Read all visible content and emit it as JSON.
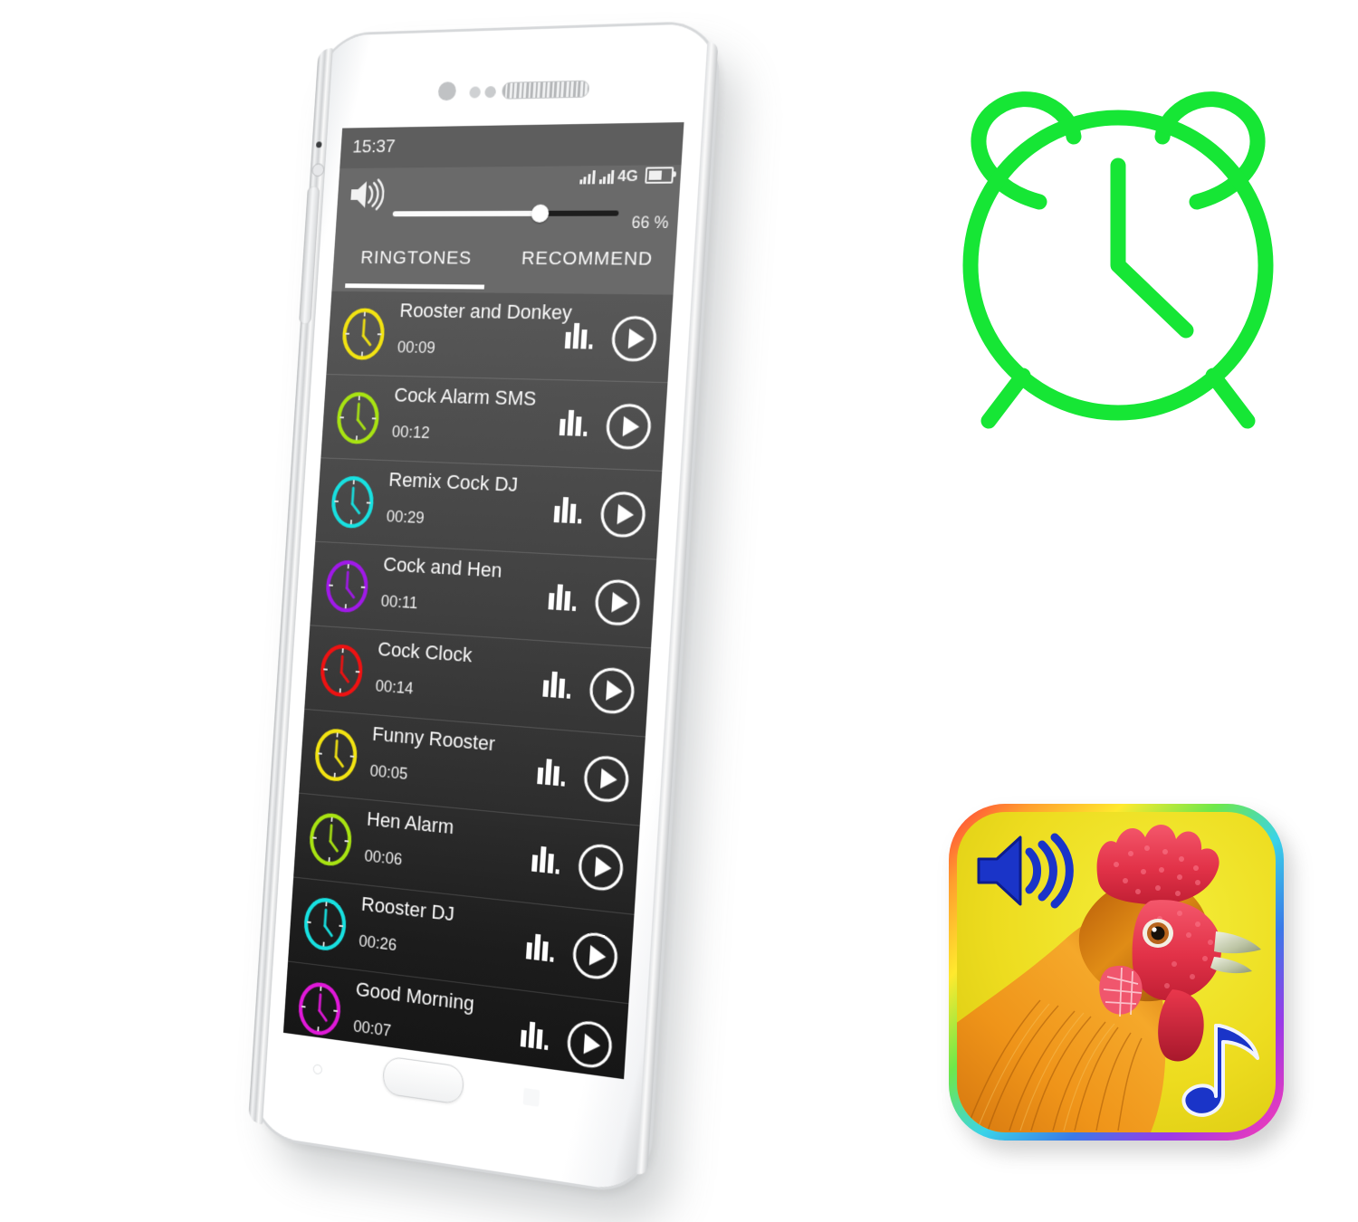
{
  "phone": {
    "status_bar": {
      "time": "15:37",
      "network_label": "4G",
      "signal_icon": "signal-bars-icon",
      "battery_icon": "battery-icon"
    },
    "volume": {
      "speaker_icon": "speaker-volume-icon",
      "percent_label": "66 %",
      "percent_value": 66
    },
    "tabs": [
      {
        "label": "RINGTONES",
        "active": true
      },
      {
        "label": "RECOMMEND",
        "active": false
      }
    ],
    "ringtones": [
      {
        "title": "Rooster and Donkey",
        "duration": "00:09",
        "clock_color": "#f2e312"
      },
      {
        "title": "Cock Alarm SMS",
        "duration": "00:12",
        "clock_color": "#a8e312"
      },
      {
        "title": "Remix Cock DJ",
        "duration": "00:29",
        "clock_color": "#18e0e0"
      },
      {
        "title": "Cock and Hen",
        "duration": "00:11",
        "clock_color": "#a019e8"
      },
      {
        "title": "Cock Clock",
        "duration": "00:14",
        "clock_color": "#ee1212"
      },
      {
        "title": "Funny Rooster",
        "duration": "00:05",
        "clock_color": "#f2e312"
      },
      {
        "title": "Hen Alarm",
        "duration": "00:06",
        "clock_color": "#a8e312"
      },
      {
        "title": "Rooster DJ",
        "duration": "00:26",
        "clock_color": "#18e0e0"
      },
      {
        "title": "Good Morning",
        "duration": "00:07",
        "clock_color": "#e018d8"
      }
    ],
    "row_icons": {
      "equalizer_icon": "equalizer-icon",
      "play_icon": "play-circle-icon",
      "clock_icon": "clock-icon"
    },
    "hardware": {
      "home_button": "home-button",
      "volume_rocker": "volume-rocker",
      "earpiece": "earpiece-speaker",
      "front_camera": "front-camera"
    }
  },
  "alarm_clock_graphic": {
    "icon": "alarm-clock-icon",
    "color": "#16e635"
  },
  "app_icon": {
    "speaker_icon": "speaker-icon",
    "music_note_icon": "music-note-icon",
    "rooster_image": "rooster-head-image",
    "background_color": "#eddc1f",
    "accent_color": "#1a34c8",
    "border_style": "rainbow-gradient"
  }
}
